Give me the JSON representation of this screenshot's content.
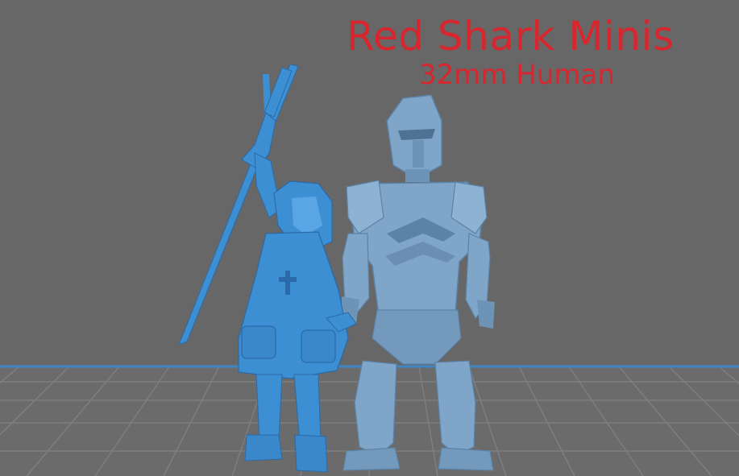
{
  "watermark": {
    "title": "Red Shark Minis",
    "subtitle": "32mm Human"
  },
  "colors": {
    "background": "#676767",
    "floor": "#6b6b6b",
    "grid_line": "#7d7d7d",
    "horizon_line": "#3f86c4",
    "figure_girl": "#3d8fd4",
    "figure_girl_shadow": "#2a6aa8",
    "figure_knight": "#7fa6c8",
    "figure_knight_shadow": "#5c82a6",
    "watermark_text": "#d8262e"
  },
  "scene": {
    "figures": [
      {
        "id": "girl",
        "description_icon": "hooded-girl-figure-icon"
      },
      {
        "id": "knight",
        "description_icon": "armored-knight-figure-icon"
      }
    ]
  }
}
